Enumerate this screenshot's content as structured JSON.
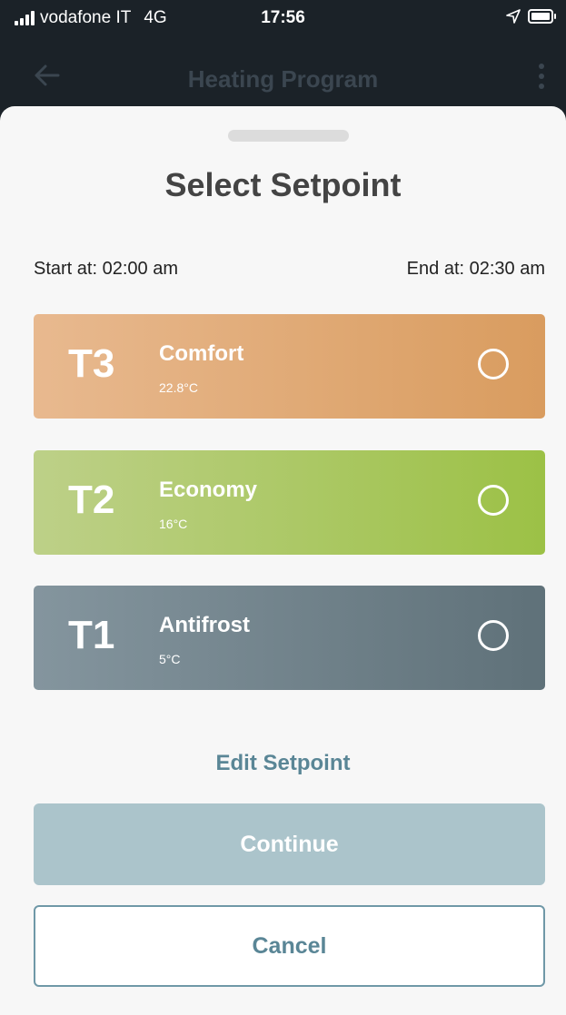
{
  "status_bar": {
    "carrier": "vodafone IT",
    "network": "4G",
    "time": "17:56",
    "location_icon": "location-arrow-icon",
    "battery_icon": "battery-icon"
  },
  "nav": {
    "back_icon": "arrow-left-icon",
    "title": "Heating Program",
    "more_icon": "more-vertical-icon"
  },
  "sheet": {
    "title": "Select Setpoint",
    "start_text": "Start at: 02:00 am",
    "end_text": "End at: 02:30 am",
    "setpoints": [
      {
        "code": "T3",
        "name": "Comfort",
        "temp": "22.8°C",
        "color_start": "#e8b98f",
        "color_end": "#d99c5f",
        "selected": false
      },
      {
        "code": "T2",
        "name": "Economy",
        "temp": "16°C",
        "color_start": "#bdd088",
        "color_end": "#9cc146",
        "selected": false
      },
      {
        "code": "T1",
        "name": "Antifrost",
        "temp": "5°C",
        "color_start": "#84959e",
        "color_end": "#5f7179",
        "selected": false
      }
    ],
    "edit_label": "Edit Setpoint",
    "continue_label": "Continue",
    "cancel_label": "Cancel"
  },
  "colors": {
    "accent": "#5a8696",
    "continue_disabled": "#abc4cb"
  }
}
